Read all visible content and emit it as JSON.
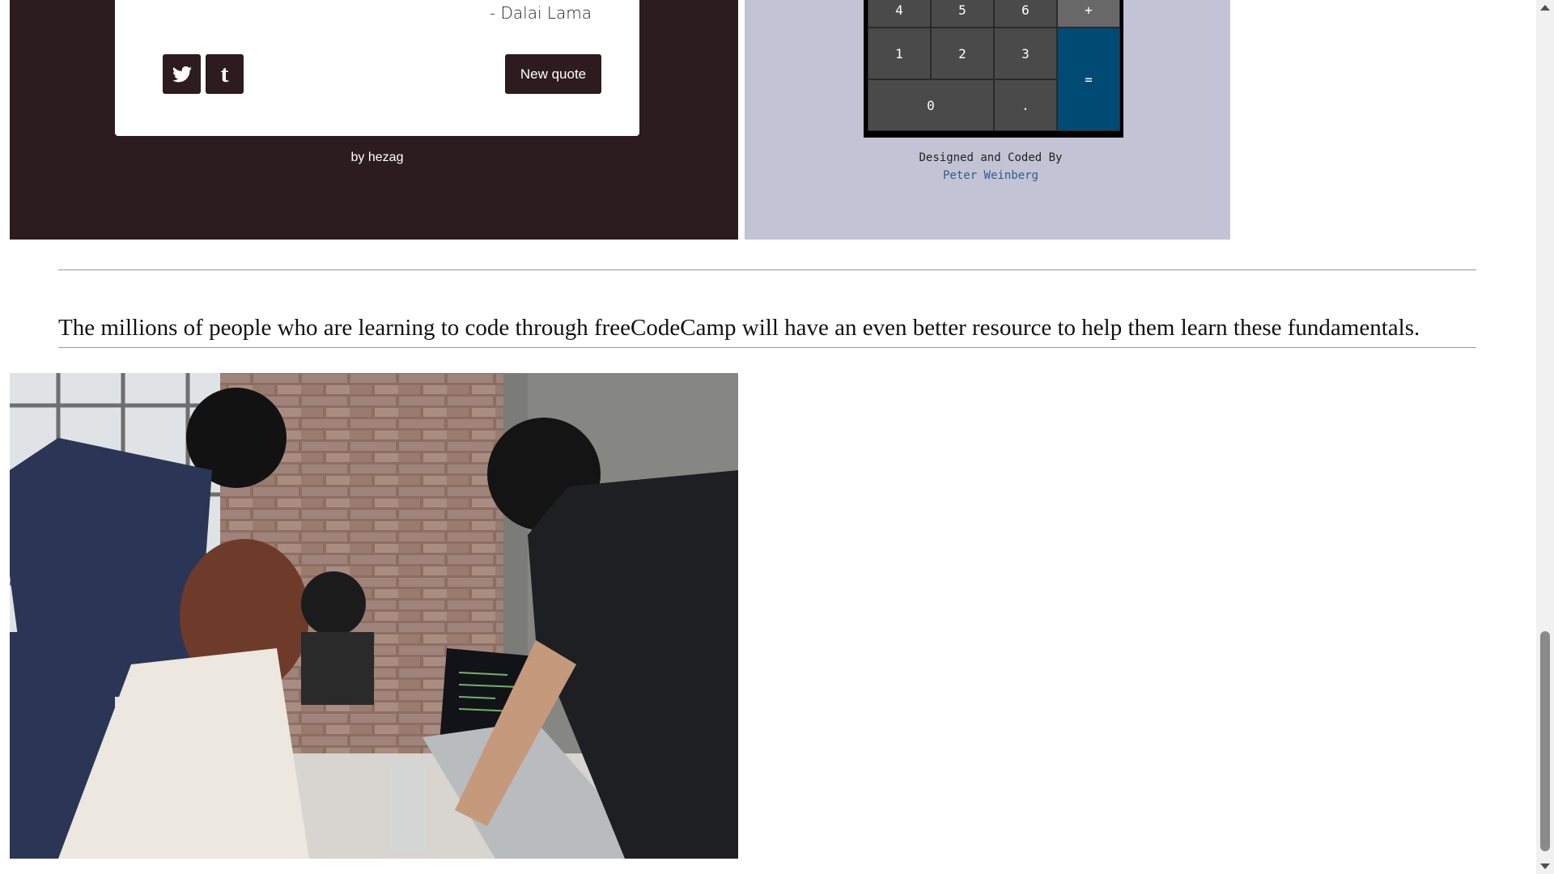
{
  "quote_machine": {
    "author": "- Dalai Lama",
    "new_quote_label": "New quote",
    "byline_prefix": "by ",
    "byline_author": "hezag",
    "icons": [
      "twitter-icon",
      "tumblr-icon"
    ],
    "tumblr_glyph": "t",
    "colors": {
      "theme": "#2d1c1f",
      "card": "#ffffff"
    }
  },
  "calculator": {
    "keys_row_top": [
      "4",
      "5",
      "6",
      "+"
    ],
    "keys_row_mid": [
      "1",
      "2",
      "3"
    ],
    "key_zero": "0",
    "key_decimal": ".",
    "key_equals": "=",
    "credit_line": "Designed and Coded By",
    "credit_author": "Peter Weinberg",
    "colors": {
      "background": "#c3c3d6",
      "key": "#4a4a4a",
      "operator": "#686868",
      "equals": "#004b74"
    }
  },
  "article": {
    "statement": "The millions of people who are learning to code through freeCodeCamp will have an even better resource to help them learn these fundamentals."
  },
  "photo": {
    "subject": "people-coding-at-laptops-photo"
  }
}
